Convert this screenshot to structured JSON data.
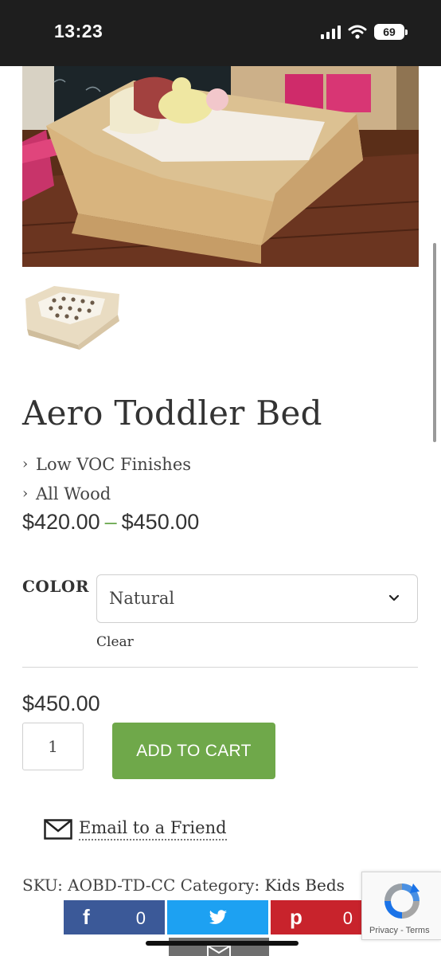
{
  "status_bar": {
    "time": "13:23",
    "battery": "69",
    "icons": [
      "signal-icon",
      "wifi-icon",
      "battery-icon"
    ]
  },
  "product": {
    "title": "Aero Toddler Bed",
    "features": [
      "Low VOC Finishes",
      "All Wood"
    ],
    "price_min": "$420.00",
    "price_separator": "–",
    "price_max": "$450.00"
  },
  "variation": {
    "label": "COLOR",
    "selected": "Natural",
    "clear_label": "Clear"
  },
  "cart": {
    "variant_price": "$450.00",
    "quantity": "1",
    "add_to_cart_label": "ADD TO CART"
  },
  "email_friend": {
    "label": "Email to a Friend",
    "icon": "envelope-icon"
  },
  "meta": {
    "sku_label": "SKU:",
    "sku": "AOBD-TD-CC",
    "category_label": "Category:",
    "category": "Kids Beds"
  },
  "share": {
    "facebook": {
      "icon": "f",
      "count": "0",
      "color": "#3b5998"
    },
    "twitter": {
      "icon": "twitter-bird-icon",
      "color": "#1da1f2"
    },
    "pinterest": {
      "icon": "p",
      "count": "0",
      "color": "#c8232c"
    },
    "email": {
      "icon": "envelope-icon"
    }
  },
  "recaptcha": {
    "privacy": "Privacy",
    "separator": "-",
    "terms": "Terms"
  },
  "colors": {
    "accent_green": "#6fa84a",
    "dash_green": "#6aa84f",
    "text": "#333333"
  }
}
